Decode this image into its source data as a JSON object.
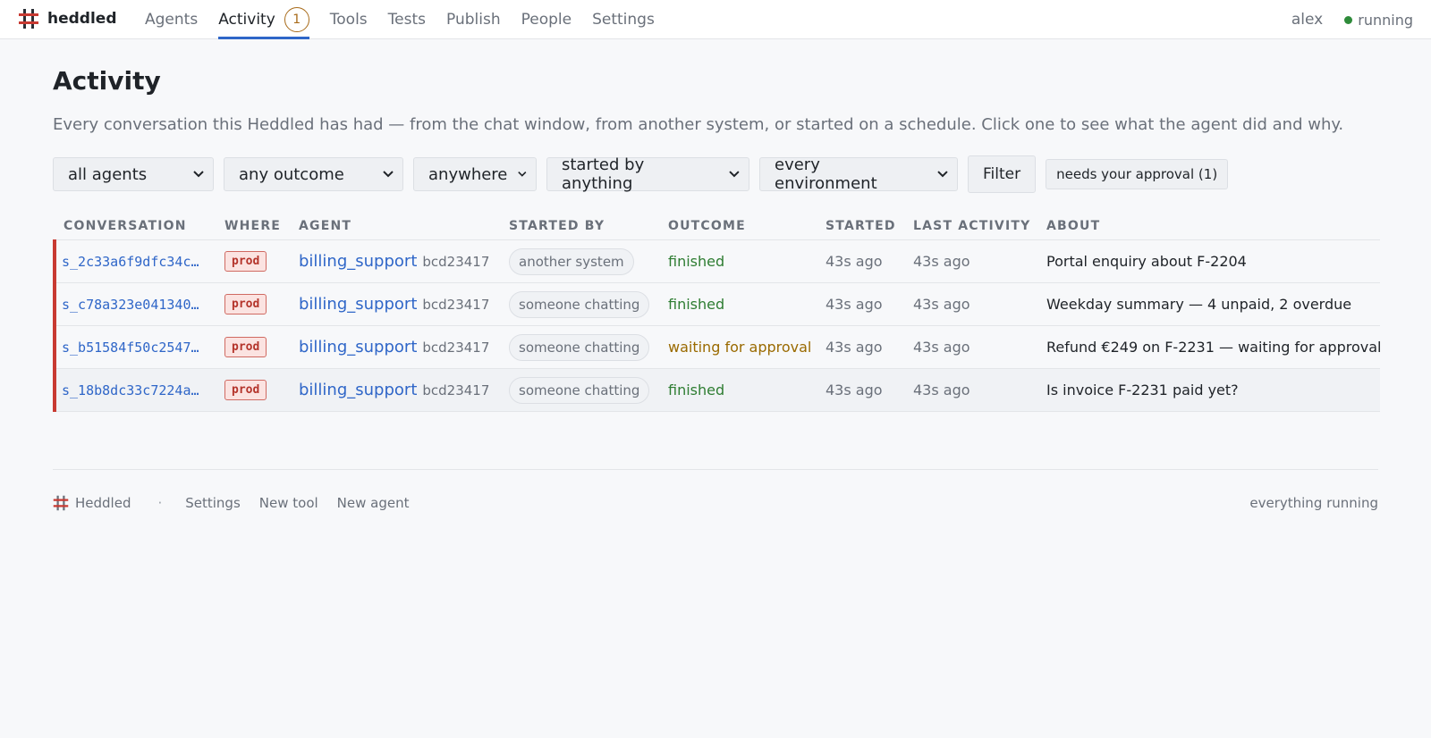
{
  "brand": {
    "name": "heddled",
    "accent": "#c83a32"
  },
  "nav": {
    "items": [
      {
        "label": "Agents"
      },
      {
        "label": "Activity",
        "badge": "1",
        "active": true
      },
      {
        "label": "Tools"
      },
      {
        "label": "Tests"
      },
      {
        "label": "Publish"
      },
      {
        "label": "People"
      },
      {
        "label": "Settings"
      }
    ],
    "user": "alex",
    "status": "running",
    "status_color": "#2e8b3a"
  },
  "page": {
    "title": "Activity",
    "intro": "Every conversation this Heddled has had — from the chat window, from another system, or started on a schedule. Click one to see what the agent did and why."
  },
  "filters": {
    "agent": "all agents",
    "outcome": "any outcome",
    "where": "anywhere",
    "started_by": "started by anything",
    "environment": "every environment",
    "filter_button": "Filter",
    "approval_button": "needs your approval (1)"
  },
  "table": {
    "headers": [
      "CONVERSATION",
      "WHERE",
      "AGENT",
      "STARTED BY",
      "OUTCOME",
      "STARTED",
      "LAST ACTIVITY",
      "ABOUT"
    ],
    "rows": [
      {
        "conversation": "s_2c33a6f9dfc34c…",
        "where": "prod",
        "agent": "billing_support",
        "version": "bcd23417",
        "started_by": "another system",
        "outcome": "finished",
        "started": "43s ago",
        "last_activity": "43s ago",
        "about": "Portal enquiry about F-2204"
      },
      {
        "conversation": "s_c78a323e041340…",
        "where": "prod",
        "agent": "billing_support",
        "version": "bcd23417",
        "started_by": "someone chatting",
        "outcome": "finished",
        "started": "43s ago",
        "last_activity": "43s ago",
        "about": "Weekday summary — 4 unpaid, 2 overdue"
      },
      {
        "conversation": "s_b51584f50c2547…",
        "where": "prod",
        "agent": "billing_support",
        "version": "bcd23417",
        "started_by": "someone chatting",
        "outcome": "waiting for approval",
        "started": "43s ago",
        "last_activity": "43s ago",
        "about": "Refund €249 on F-2231 — waiting for approval"
      },
      {
        "conversation": "s_18b8dc33c7224a…",
        "where": "prod",
        "agent": "billing_support",
        "version": "bcd23417",
        "started_by": "someone chatting",
        "outcome": "finished",
        "started": "43s ago",
        "last_activity": "43s ago",
        "about": "Is invoice F-2231 paid yet?"
      }
    ]
  },
  "footer": {
    "brand": "Heddled",
    "separator": "·",
    "links": [
      "Settings",
      "New tool",
      "New agent"
    ],
    "status": "everything running"
  }
}
